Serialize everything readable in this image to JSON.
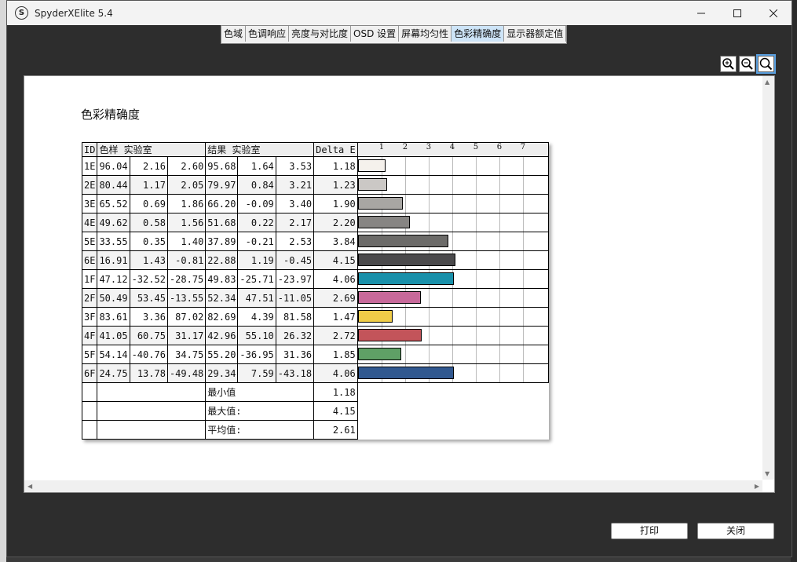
{
  "window": {
    "title": "SpyderXElite 5.4"
  },
  "tabs": [
    {
      "label": "色域",
      "active": false
    },
    {
      "label": "色调响应",
      "active": false
    },
    {
      "label": "亮度与对比度",
      "active": false
    },
    {
      "label": "OSD 设置",
      "active": false
    },
    {
      "label": "屏幕均匀性",
      "active": false
    },
    {
      "label": "色彩精确度",
      "active": true
    },
    {
      "label": "显示器额定值",
      "active": false
    }
  ],
  "report": {
    "title": "色彩精确度",
    "headers": {
      "id": "ID",
      "sample": "色样 实验室",
      "result": "结果 实验室",
      "delta": "Delta E"
    },
    "ticks": [
      "1",
      "2",
      "3",
      "4",
      "5",
      "6",
      "7"
    ],
    "rows": [
      {
        "id": "1E",
        "s": [
          "96.04",
          "2.16",
          "2.60"
        ],
        "r": [
          "95.68",
          "1.64",
          "3.53"
        ],
        "d": "1.18",
        "color": "#f5f1ec"
      },
      {
        "id": "2E",
        "s": [
          "80.44",
          "1.17",
          "2.05"
        ],
        "r": [
          "79.97",
          "0.84",
          "3.21"
        ],
        "d": "1.23",
        "color": "#cbc8c5"
      },
      {
        "id": "3E",
        "s": [
          "65.52",
          "0.69",
          "1.86"
        ],
        "r": [
          "66.20",
          "-0.09",
          "3.40"
        ],
        "d": "1.90",
        "color": "#a8a6a3"
      },
      {
        "id": "4E",
        "s": [
          "49.62",
          "0.58",
          "1.56"
        ],
        "r": [
          "51.68",
          "0.22",
          "2.17"
        ],
        "d": "2.20",
        "color": "#878583"
      },
      {
        "id": "5E",
        "s": [
          "33.55",
          "0.35",
          "1.40"
        ],
        "r": [
          "37.89",
          "-0.21",
          "2.53"
        ],
        "d": "3.84",
        "color": "#6c6b69"
      },
      {
        "id": "6E",
        "s": [
          "16.91",
          "1.43",
          "-0.81"
        ],
        "r": [
          "22.88",
          "1.19",
          "-0.45"
        ],
        "d": "4.15",
        "color": "#4b4a4c"
      },
      {
        "id": "1F",
        "s": [
          "47.12",
          "-32.52",
          "-28.75"
        ],
        "r": [
          "49.83",
          "-25.71",
          "-23.97"
        ],
        "d": "4.06",
        "color": "#1990aa"
      },
      {
        "id": "2F",
        "s": [
          "50.49",
          "53.45",
          "-13.55"
        ],
        "r": [
          "52.34",
          "47.51",
          "-11.05"
        ],
        "d": "2.69",
        "color": "#c7699a"
      },
      {
        "id": "3F",
        "s": [
          "83.61",
          "3.36",
          "87.02"
        ],
        "r": [
          "82.69",
          "4.39",
          "81.58"
        ],
        "d": "1.47",
        "color": "#f0cc48"
      },
      {
        "id": "4F",
        "s": [
          "41.05",
          "60.75",
          "31.17"
        ],
        "r": [
          "42.96",
          "55.10",
          "26.32"
        ],
        "d": "2.72",
        "color": "#c3545a"
      },
      {
        "id": "5F",
        "s": [
          "54.14",
          "-40.76",
          "34.75"
        ],
        "r": [
          "55.20",
          "-36.95",
          "31.36"
        ],
        "d": "1.85",
        "color": "#5fa066"
      },
      {
        "id": "6F",
        "s": [
          "24.75",
          "13.78",
          "-49.48"
        ],
        "r": [
          "29.34",
          "7.59",
          "-43.18"
        ],
        "d": "4.06",
        "color": "#315890"
      }
    ],
    "summary": [
      {
        "label": "最小值",
        "value": "1.18"
      },
      {
        "label": "最大值:",
        "value": "4.15"
      },
      {
        "label": "平均值:",
        "value": "2.61"
      }
    ]
  },
  "buttons": {
    "print": "打印",
    "close": "关闭"
  }
}
